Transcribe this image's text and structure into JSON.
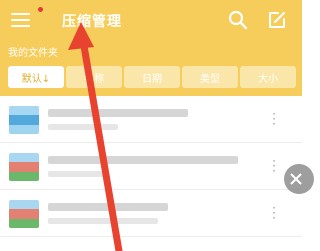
{
  "header": {
    "title": "压缩管理",
    "menu_icon": "hamburger-icon",
    "search_icon": "search-icon",
    "edit_icon": "edit-icon",
    "accent": "#f6cc5a",
    "notification_color": "#e53935"
  },
  "folder": {
    "label": "我的文件夹"
  },
  "sort_tabs": [
    {
      "label": "默认↓",
      "active": true
    },
    {
      "label": "名称",
      "active": false
    },
    {
      "label": "日期",
      "active": false
    },
    {
      "label": "类型",
      "active": false
    },
    {
      "label": "大小",
      "active": false
    }
  ],
  "files": [
    {
      "thumb_icon": "image-file-icon",
      "more_icon": "more-vertical-icon"
    },
    {
      "thumb_icon": "archive-file-icon",
      "more_icon": "more-vertical-icon"
    },
    {
      "thumb_icon": "archive-file-icon",
      "more_icon": "more-vertical-icon"
    }
  ],
  "overlay": {
    "annotation_icon": "red-arrow-icon",
    "side_button_icon": "close-icon"
  }
}
